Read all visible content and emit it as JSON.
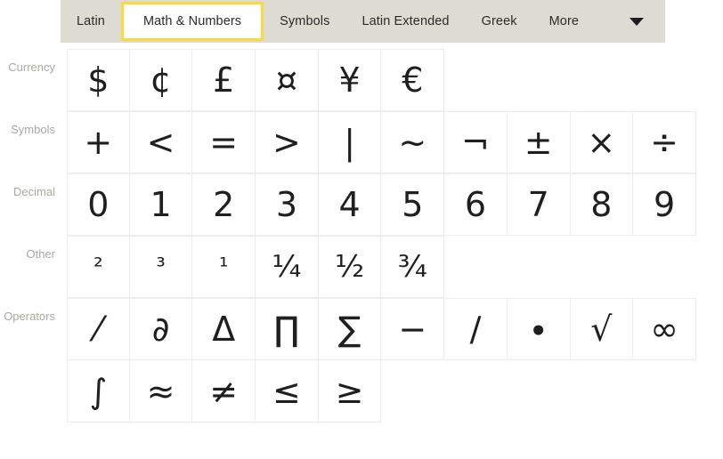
{
  "tabbar": {
    "tabs": [
      {
        "label": "Latin",
        "selected": false
      },
      {
        "label": "Math & Numbers",
        "selected": true
      },
      {
        "label": "Symbols",
        "selected": false
      },
      {
        "label": "Latin Extended",
        "selected": false
      },
      {
        "label": "Greek",
        "selected": false
      },
      {
        "label": "More",
        "selected": false
      }
    ],
    "dropdown_icon": "chevron-down-icon",
    "background_color": "#dcdcd2",
    "selected_outline_color": "#ffd83d"
  },
  "sections": [
    {
      "label": "Currency",
      "rows": [
        [
          "$",
          "¢",
          "£",
          "¤",
          "¥",
          "€"
        ]
      ]
    },
    {
      "label": "Symbols",
      "rows": [
        [
          "+",
          "<",
          "=",
          ">",
          "|",
          "~",
          "¬",
          "±",
          "×",
          "÷"
        ]
      ]
    },
    {
      "label": "Decimal",
      "rows": [
        [
          "0",
          "1",
          "2",
          "3",
          "4",
          "5",
          "6",
          "7",
          "8",
          "9"
        ]
      ]
    },
    {
      "label": "Other",
      "rows": [
        [
          "²",
          "³",
          "¹",
          "¼",
          "½",
          "¾"
        ]
      ]
    },
    {
      "label": "Operators",
      "rows": [
        [
          "⁄",
          "∂",
          "Δ",
          "∏",
          "∑",
          "−",
          "∕",
          "∙",
          "√",
          "∞"
        ],
        [
          "∫",
          "≈",
          "≠",
          "≤",
          "≥"
        ]
      ]
    }
  ]
}
